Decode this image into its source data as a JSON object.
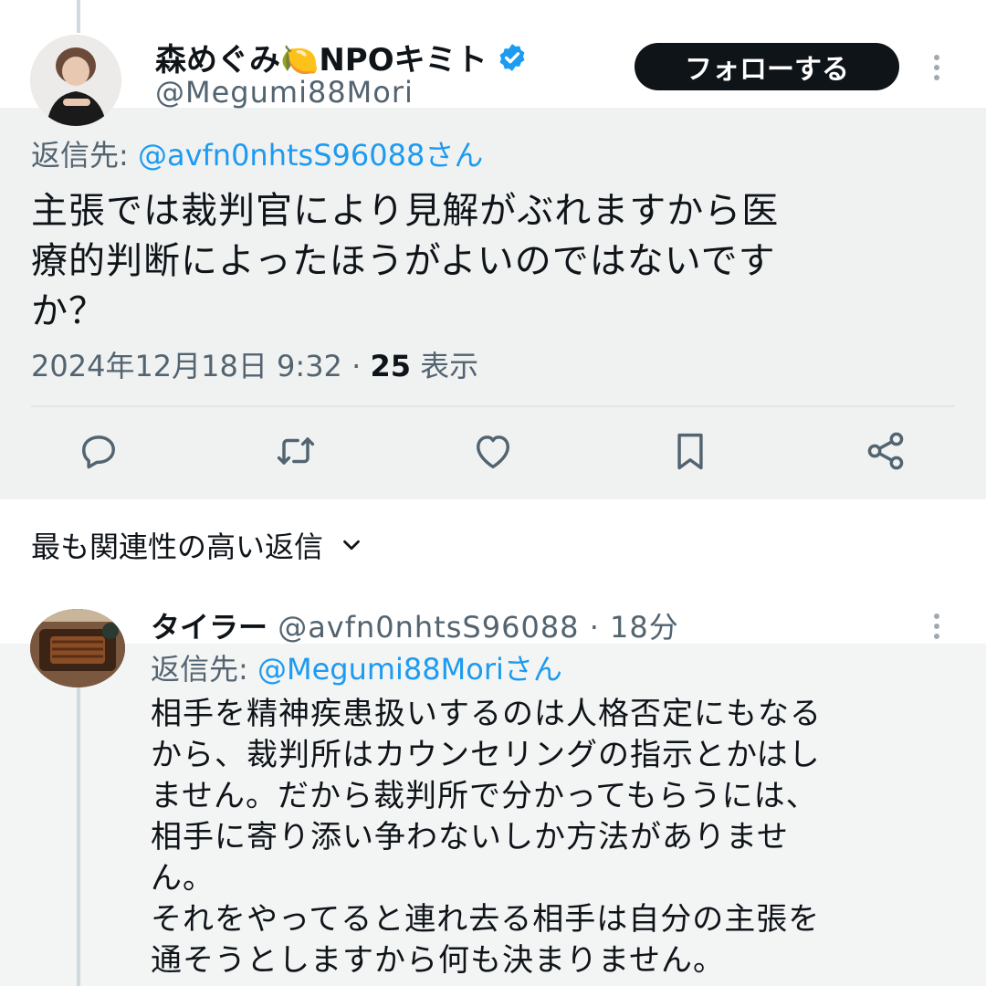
{
  "main_tweet": {
    "author_name": "森めぐみ🍋NPOキミト",
    "author_handle": "@Megumi88Mori",
    "follow_label": "フォローする",
    "reply_to_prefix": "返信先: ",
    "reply_to_mention": "@avfn0nhtsS96088さん",
    "text_lines": [
      "主張では裁判官により見解がぶれますから医",
      "療的判断によったほうがよいのではないです",
      "か？"
    ],
    "timestamp": "2024年12月18日 9:32 · ",
    "views_count": "25",
    "views_label": " 表示",
    "actions": [
      "reply-icon",
      "retweet-icon",
      "like-icon",
      "bookmark-icon",
      "share-icon"
    ]
  },
  "sort": {
    "label": "最も関連性の高い返信"
  },
  "reply_tweet": {
    "author_name": "タイラー",
    "author_handle": " @avfn0nhtsS96088 · 18分",
    "reply_to_prefix": "返信先: ",
    "reply_to_mention": "@Megumi88Moriさん",
    "text_lines": [
      "相手を精神疾患扱いするのは人格否定にもなる",
      "から、裁判所はカウンセリングの指示とかはし",
      "ません。だから裁判所で分かってもらうには、",
      "相手に寄り添い争わないしか方法がありませ",
      "ん。",
      "それをやってると連れ去る相手は自分の主張を",
      "通そうとしますから何も決まりません。"
    ]
  },
  "colors": {
    "link": "#1d9bf0",
    "muted": "#536471",
    "text": "#0f1419",
    "follow_bg": "#0f1419",
    "tweet_bg": "#f0f2f2"
  }
}
